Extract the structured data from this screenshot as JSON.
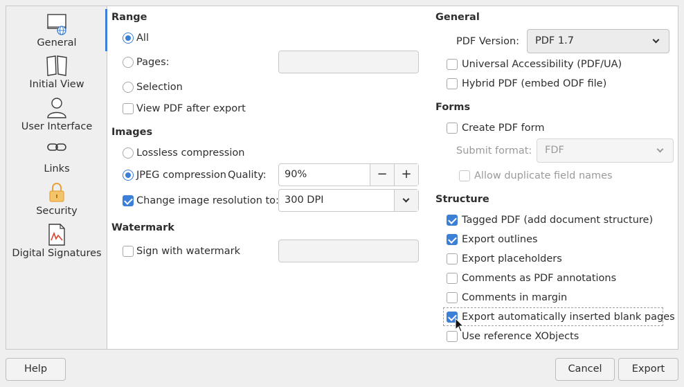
{
  "sidebar": {
    "items": [
      {
        "label": "General",
        "icon": "general-icon"
      },
      {
        "label": "Initial View",
        "icon": "initial-view-icon"
      },
      {
        "label": "User Interface",
        "icon": "user-icon"
      },
      {
        "label": "Links",
        "icon": "link-icon"
      },
      {
        "label": "Security",
        "icon": "lock-icon"
      },
      {
        "label": "Digital Signatures",
        "icon": "signature-icon"
      }
    ],
    "selected": "General"
  },
  "range": {
    "heading": "Range",
    "all": "All",
    "pages": "Pages:",
    "pages_value": "",
    "selection": "Selection",
    "view_pdf": "View PDF after export"
  },
  "images": {
    "heading": "Images",
    "lossless": "Lossless compression",
    "jpeg": "JPEG compression",
    "quality_label": "Quality:",
    "quality_value": "90%",
    "minus": "−",
    "plus": "+",
    "change_res": "Change image resolution to:",
    "res_value": "300 DPI"
  },
  "watermark": {
    "heading": "Watermark",
    "sign": "Sign with watermark",
    "value": ""
  },
  "general": {
    "heading": "General",
    "pdf_version_label": "PDF Version:",
    "pdf_version_value": "PDF 1.7",
    "universal": "Universal Accessibility (PDF/UA)",
    "hybrid": "Hybrid PDF (embed ODF file)"
  },
  "forms": {
    "heading": "Forms",
    "create": "Create PDF form",
    "submit_label": "Submit format:",
    "submit_value": "FDF",
    "allow_dup": "Allow duplicate field names"
  },
  "structure": {
    "heading": "Structure",
    "tagged": "Tagged PDF (add document structure)",
    "outlines": "Export outlines",
    "placeholders": "Export placeholders",
    "comments_annot": "Comments as PDF annotations",
    "comments_margin": "Comments in margin",
    "blank_pages": "Export automatically inserted blank pages",
    "xobjects": "Use reference XObjects"
  },
  "footer": {
    "help": "Help",
    "cancel": "Cancel",
    "export": "Export"
  },
  "colors": {
    "accent": "#3b7fd6"
  }
}
